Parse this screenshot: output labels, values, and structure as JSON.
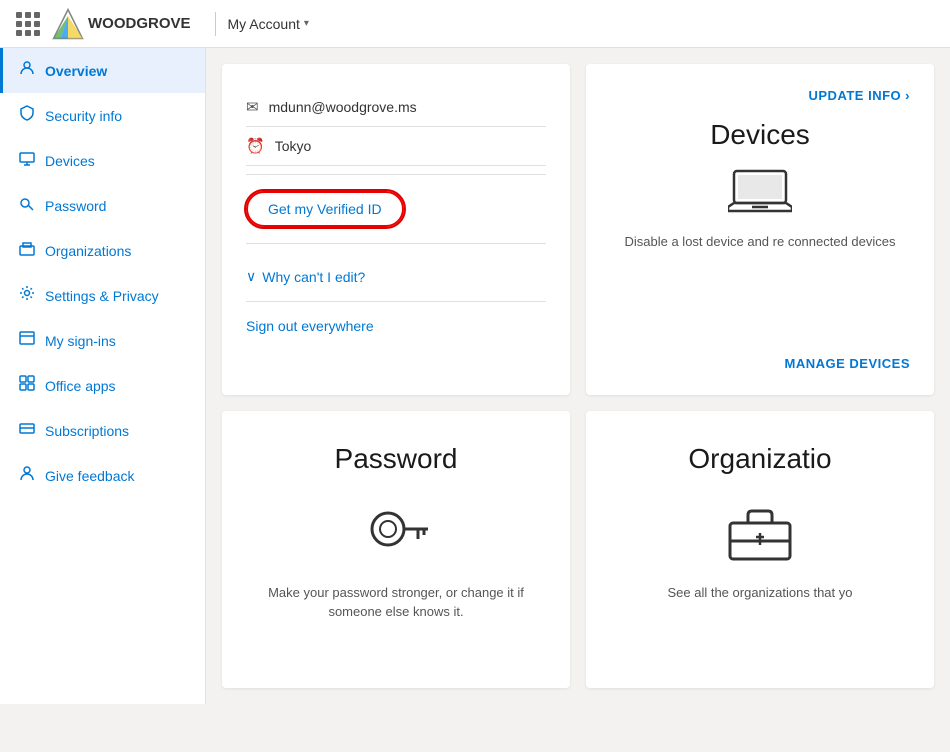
{
  "topbar": {
    "logo_text": "WOODGROVE",
    "account_label": "My Account",
    "chevron": "▾"
  },
  "sidebar": {
    "items": [
      {
        "id": "overview",
        "label": "Overview",
        "icon": "👤",
        "active": true
      },
      {
        "id": "security-info",
        "label": "Security info",
        "icon": "🔒"
      },
      {
        "id": "devices",
        "label": "Devices",
        "icon": "💻"
      },
      {
        "id": "password",
        "label": "Password",
        "icon": "🔑"
      },
      {
        "id": "organizations",
        "label": "Organizations",
        "icon": "🏢"
      },
      {
        "id": "settings-privacy",
        "label": "Settings & Privacy",
        "icon": "⚙"
      },
      {
        "id": "my-sign-ins",
        "label": "My sign-ins",
        "icon": "📋"
      },
      {
        "id": "office-apps",
        "label": "Office apps",
        "icon": "🖥"
      },
      {
        "id": "subscriptions",
        "label": "Subscriptions",
        "icon": "💳"
      },
      {
        "id": "give-feedback",
        "label": "Give feedback",
        "icon": "👤"
      }
    ]
  },
  "profile_card": {
    "email": "mdunn@woodgrove.ms",
    "location": "Tokyo",
    "verified_id_label": "Get my Verified ID",
    "why_cant_edit_label": "Why can't I edit?",
    "sign_out_label": "Sign out everywhere"
  },
  "devices_card": {
    "update_info_label": "UPDATE INFO",
    "update_info_arrow": "›",
    "title": "Devices",
    "description": "Disable a lost device and re connected devices",
    "manage_label": "MANAGE DEVICES"
  },
  "password_card": {
    "title": "Password",
    "description": "Make your password stronger, or change it if someone else knows it."
  },
  "org_card": {
    "title": "Organizatio",
    "description": "See all the organizations that yo"
  }
}
